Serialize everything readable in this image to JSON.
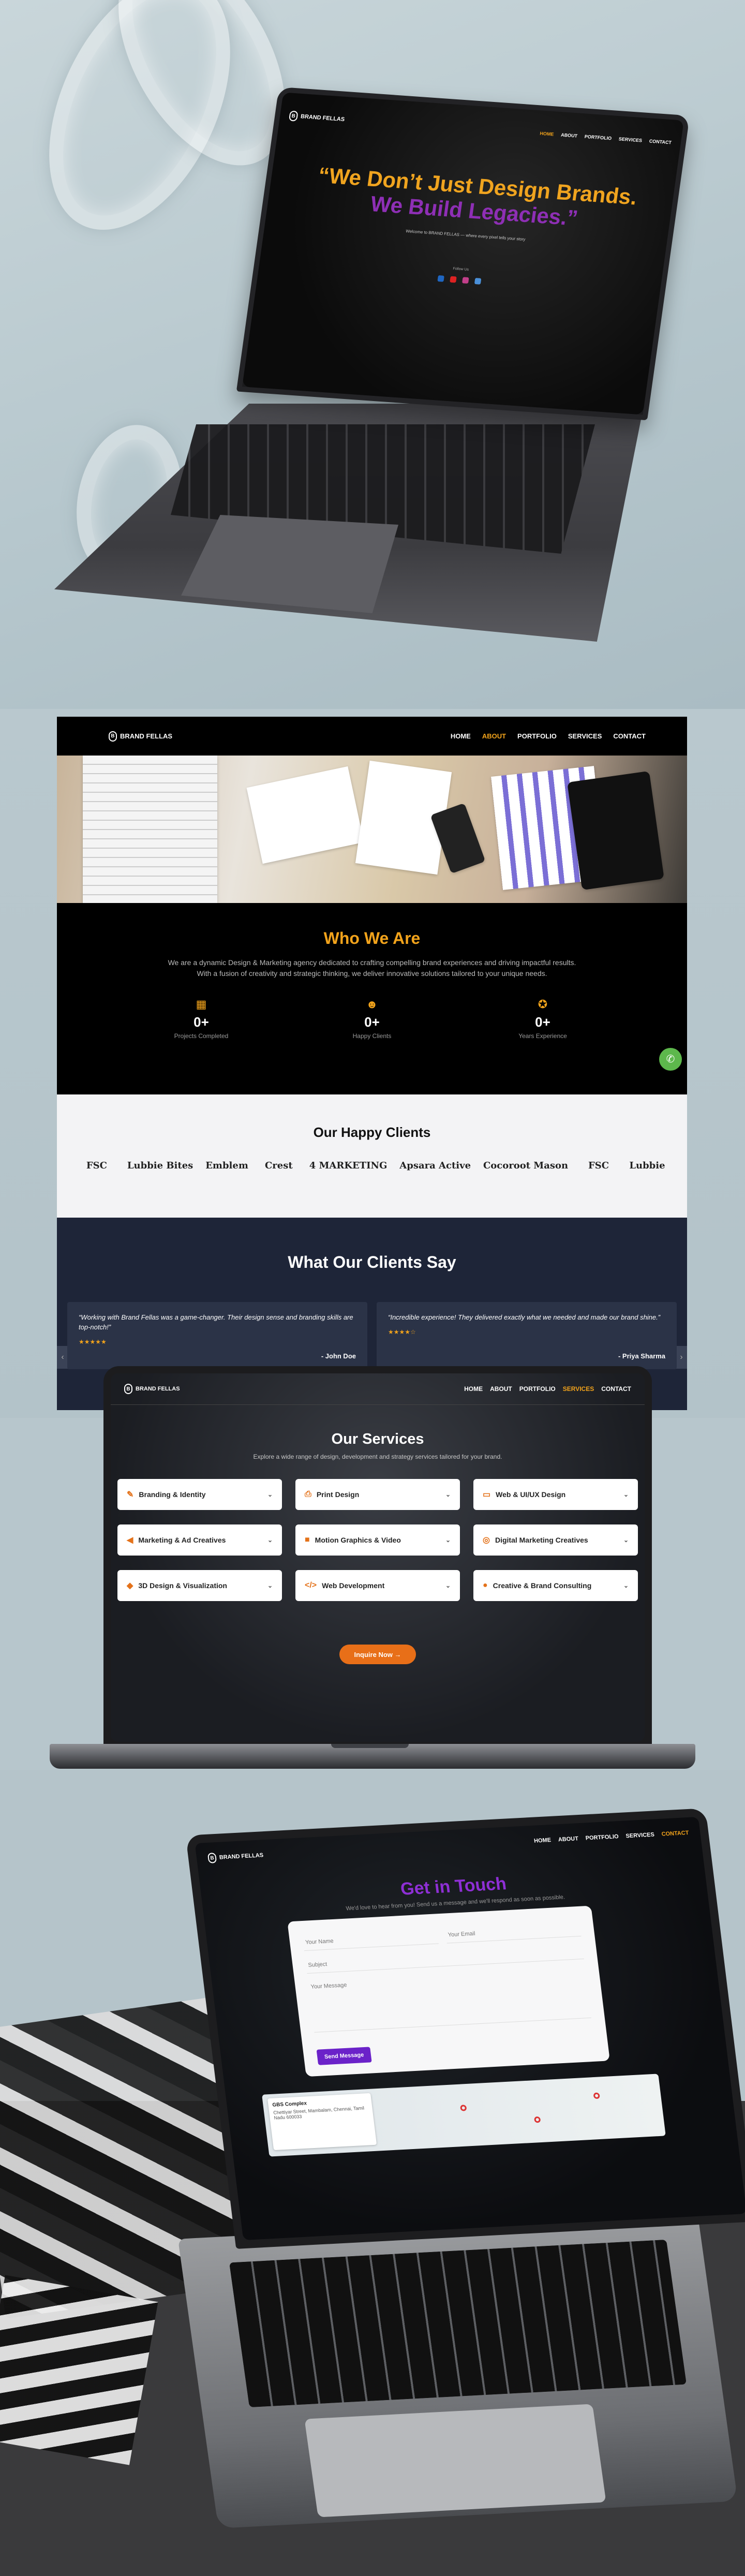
{
  "brand": {
    "name": "BRAND FELLAS",
    "mark": "B"
  },
  "nav": {
    "items": [
      "HOME",
      "ABOUT",
      "PORTFOLIO",
      "SERVICES",
      "CONTACT"
    ]
  },
  "hero": {
    "line1": "“We Don’t Just Design Brands.",
    "line2": "We Build Legacies.”",
    "sub": "Welcome to BRAND FELLAS — where every pixel tells your story",
    "social_label": "Follow Us",
    "colors": {
      "primary": "#f0a41f",
      "secondary": "#8e2fb5"
    }
  },
  "about": {
    "title": "Who We Are",
    "body": "We are a dynamic Design & Marketing agency dedicated to crafting compelling brand experiences and driving impactful results. With a fusion of creativity and strategic thinking, we deliver innovative solutions tailored to your unique needs.",
    "stats": [
      {
        "icon": "calendar-icon",
        "value": "0+",
        "label": "Projects Completed"
      },
      {
        "icon": "people-icon",
        "value": "0+",
        "label": "Happy Clients"
      },
      {
        "icon": "award-icon",
        "value": "0+",
        "label": "Years Experience"
      }
    ]
  },
  "clients": {
    "title": "Our Happy Clients",
    "logos": [
      "FSC",
      "Lubbie Bites",
      "Emblem",
      "Crest",
      "4 MARKETING",
      "Apsara Active",
      "Cocoroot Mason",
      "FSC",
      "Lubbie"
    ]
  },
  "testimonials": {
    "title": "What Our Clients Say",
    "items": [
      {
        "quote": "“Working with Brand Fellas was a game-changer. Their design sense and branding skills are top-notch!”",
        "stars": "★★★★★",
        "name": "- John Doe"
      },
      {
        "quote": "“Incredible experience! They delivered exactly what we needed and made our brand shine.”",
        "stars": "★★★★☆",
        "name": "- Priya Sharma"
      }
    ]
  },
  "services": {
    "title": "Our Services",
    "sub": "Explore a wide range of design, development and strategy services tailored for your brand.",
    "items": [
      {
        "icon": "pen-icon",
        "label": "Branding & Identity"
      },
      {
        "icon": "print-icon",
        "label": "Print Design"
      },
      {
        "icon": "monitor-icon",
        "label": "Web & UI/UX Design"
      },
      {
        "icon": "megaphone-icon",
        "label": "Marketing & Ad Creatives"
      },
      {
        "icon": "video-icon",
        "label": "Motion Graphics & Video"
      },
      {
        "icon": "globe-icon",
        "label": "Digital Marketing Creatives"
      },
      {
        "icon": "cube-icon",
        "label": "3D Design & Visualization"
      },
      {
        "icon": "code-icon",
        "label": "Web Development"
      },
      {
        "icon": "bulb-icon",
        "label": "Creative & Brand Consulting"
      }
    ],
    "cta": "Inquire Now →"
  },
  "contact": {
    "title": "Get in Touch",
    "sub": "We'd love to hear from you! Send us a message and we'll respond as soon as possible.",
    "name_placeholder": "Your Name",
    "email_placeholder": "Your Email",
    "subject_placeholder": "Subject",
    "message_placeholder": "Your Message",
    "send": "Send Message",
    "map_title": "GBS Complex",
    "map_addr": "Chettiyar Street, Mambalam, Chennai, Tamil Nadu 600033"
  }
}
